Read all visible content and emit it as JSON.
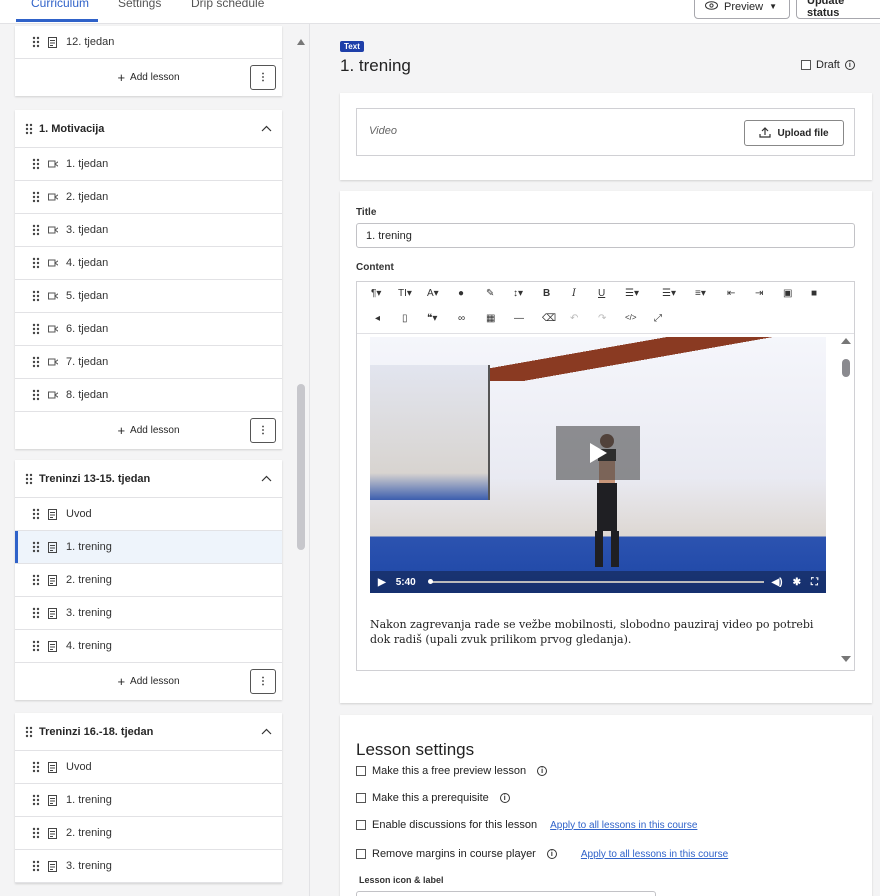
{
  "tabs": [
    {
      "label": "Curriculum",
      "active": true
    },
    {
      "label": "Settings",
      "active": false
    },
    {
      "label": "Drip schedule",
      "active": false
    }
  ],
  "header_actions": {
    "preview": "Preview",
    "update": "Update status"
  },
  "curriculum": {
    "add_lesson_label": "Add lesson",
    "sections": [
      {
        "title": "",
        "lessons": [
          {
            "label": "12. tjedan",
            "icon": "text-lesson-icon"
          }
        ]
      },
      {
        "title": "1. Motivacija",
        "lessons": [
          {
            "label": "1. tjedan",
            "icon": "video-lesson-icon"
          },
          {
            "label": "2. tjedan",
            "icon": "video-lesson-icon"
          },
          {
            "label": "3. tjedan",
            "icon": "video-lesson-icon"
          },
          {
            "label": "4. tjedan",
            "icon": "video-lesson-icon"
          },
          {
            "label": "5. tjedan",
            "icon": "video-lesson-icon"
          },
          {
            "label": "6. tjedan",
            "icon": "video-lesson-icon"
          },
          {
            "label": "7. tjedan",
            "icon": "video-lesson-icon"
          },
          {
            "label": "8. tjedan",
            "icon": "video-lesson-icon"
          }
        ]
      },
      {
        "title": "Treninzi 13-15. tjedan",
        "lessons": [
          {
            "label": "Uvod",
            "icon": "text-lesson-icon"
          },
          {
            "label": "1. trening",
            "icon": "text-lesson-icon",
            "selected": true
          },
          {
            "label": "2. trening",
            "icon": "text-lesson-icon"
          },
          {
            "label": "3. trening",
            "icon": "text-lesson-icon"
          },
          {
            "label": "4. trening",
            "icon": "text-lesson-icon"
          }
        ]
      },
      {
        "title": "Treninzi 16.-18. tjedan",
        "lessons": [
          {
            "label": "Uvod",
            "icon": "text-lesson-icon"
          },
          {
            "label": "1. trening",
            "icon": "text-lesson-icon"
          },
          {
            "label": "2. trening",
            "icon": "text-lesson-icon"
          },
          {
            "label": "3. trening",
            "icon": "text-lesson-icon"
          }
        ]
      }
    ]
  },
  "lesson": {
    "type_badge": "Text",
    "title": "1. trening",
    "draft_label": "Draft",
    "video_placeholder": "Video",
    "upload_label": "Upload file",
    "title_field_label": "Title",
    "title_value": "1. trening",
    "content_label": "Content",
    "video_time": "5:40",
    "content_text": "Nakon zagrevanja rade se vežbe mobilnosti, slobodno pauziraj video po potrebi dok radiš (upali zvuk prilikom prvog gledanja)."
  },
  "lesson_settings": {
    "title": "Lesson settings",
    "options": [
      {
        "label": "Make this a free preview lesson",
        "info": true,
        "link": ""
      },
      {
        "label": "Make this a prerequisite",
        "info": true,
        "link": ""
      },
      {
        "label": "Enable discussions for this lesson",
        "info": false,
        "link": "Apply to all lessons in this course"
      },
      {
        "label": "Remove margins in course player",
        "info": true,
        "link": "Apply to all lessons in this course"
      }
    ],
    "icon_label": "Lesson icon & label"
  },
  "colors": {
    "accent": "#2f62c9",
    "badge": "#1e3fa9"
  }
}
